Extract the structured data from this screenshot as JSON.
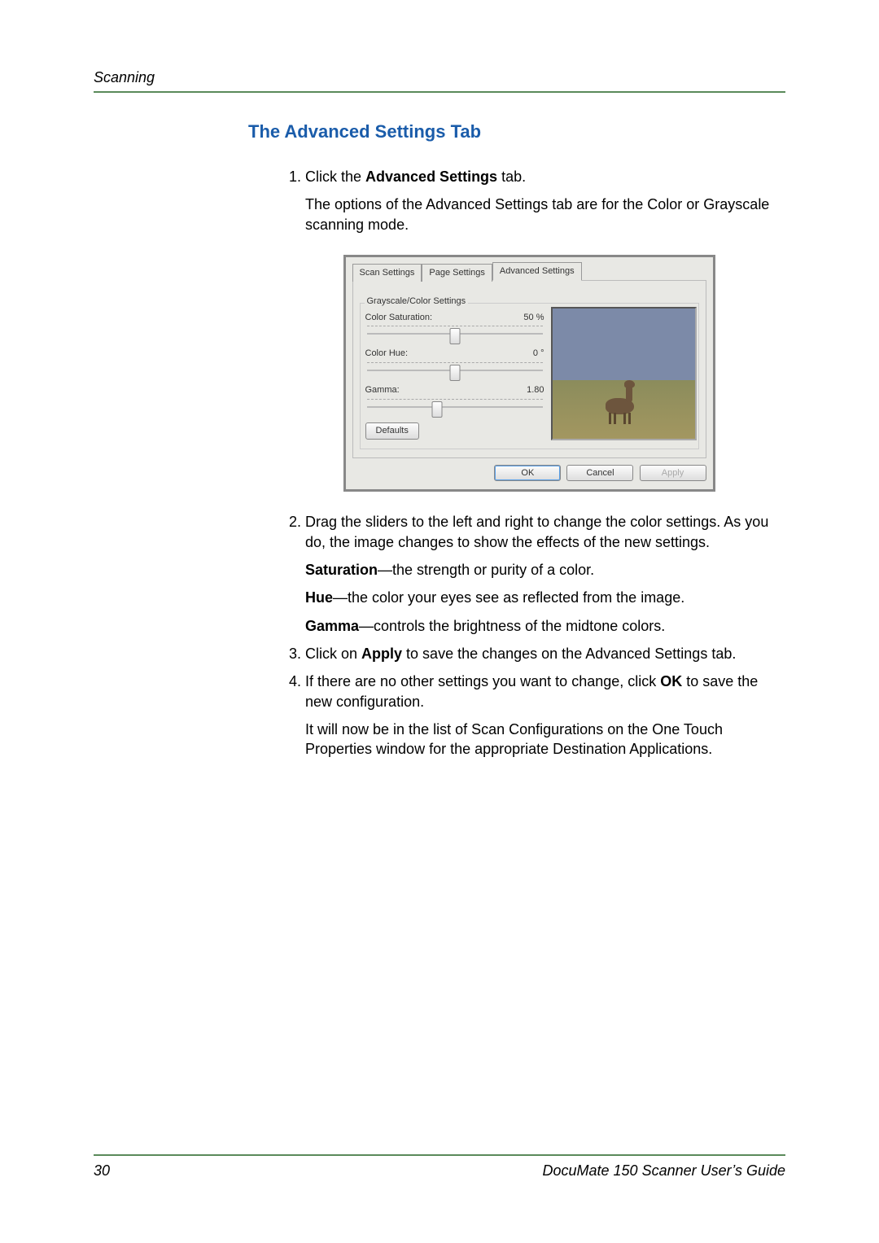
{
  "header": {
    "section": "Scanning"
  },
  "heading": "The Advanced Settings Tab",
  "steps": {
    "s1": {
      "pre": "Click the ",
      "bold": "Advanced Settings",
      "post": " tab.",
      "note": "The options of the Advanced Settings tab are for the Color or Grayscale scanning mode."
    },
    "s2": {
      "intro": "Drag the sliders to the left and right to change the color settings. As you do, the image changes to show the effects of the new settings.",
      "sat_b": "Saturation",
      "sat_rest": "—the strength or purity of a color.",
      "hue_b": "Hue",
      "hue_rest": "—the color your eyes see as reflected from the image.",
      "gam_b": "Gamma",
      "gam_rest": "—controls the brightness of the midtone colors."
    },
    "s3": {
      "pre": "Click on ",
      "bold": "Apply",
      "post": " to save the changes on the Advanced Settings tab."
    },
    "s4": {
      "pre": "If there are no other settings you want to change, click ",
      "bold": "OK",
      "post": " to save the new configuration.",
      "note": "It will now be in the list of Scan Configurations on the One Touch Properties window for the appropriate Destination Applications."
    }
  },
  "dialog": {
    "tabs": {
      "t1": "Scan Settings",
      "t2": "Page Settings",
      "t3": "Advanced Settings"
    },
    "group_label": "Grayscale/Color Settings",
    "sliders": {
      "sat": {
        "label": "Color Saturation:",
        "value": "50 %",
        "pos": 50
      },
      "hue": {
        "label": "Color Hue:",
        "value": "0 °",
        "pos": 50
      },
      "gamma": {
        "label": "Gamma:",
        "value": "1.80",
        "pos": 40
      }
    },
    "buttons": {
      "defaults": "Defaults",
      "ok": "OK",
      "cancel": "Cancel",
      "apply": "Apply"
    }
  },
  "footer": {
    "page": "30",
    "title": "DocuMate 150 Scanner User’s Guide"
  }
}
